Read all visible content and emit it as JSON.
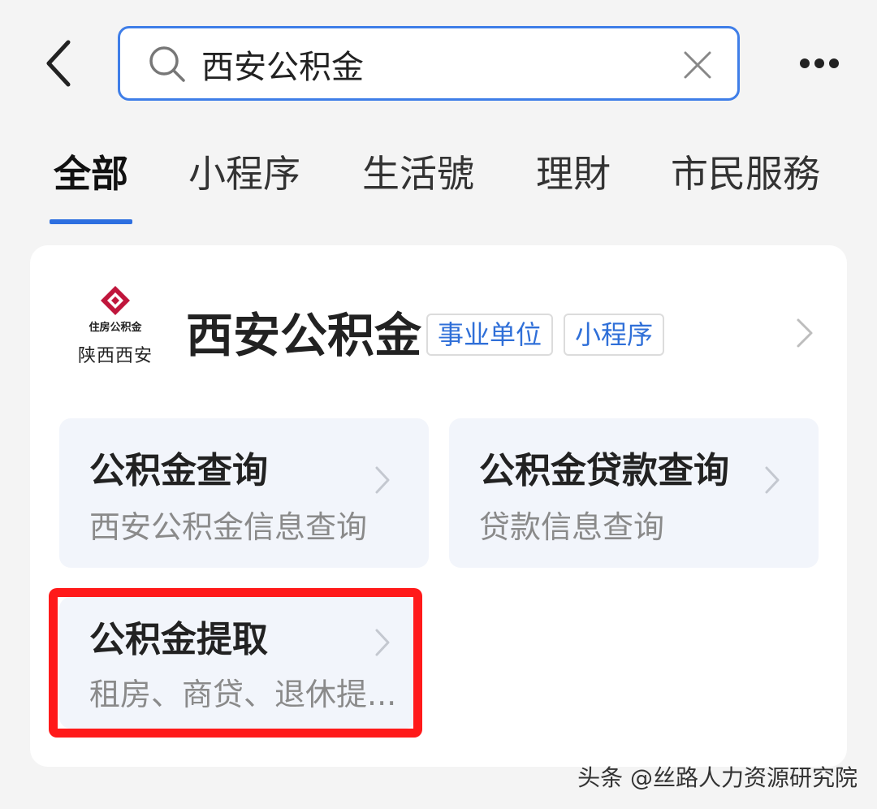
{
  "search": {
    "value": "西安公积金"
  },
  "tabs": [
    {
      "label": "全部",
      "active": true
    },
    {
      "label": "小程序",
      "active": false
    },
    {
      "label": "生活號",
      "active": false
    },
    {
      "label": "理財",
      "active": false
    },
    {
      "label": "市民服務",
      "active": false
    }
  ],
  "result": {
    "logo": {
      "small_text": "住房公积金",
      "big_text": "陕西西安"
    },
    "title": "西安公积金",
    "tags": [
      "事业单位",
      "小程序"
    ],
    "tiles": [
      {
        "title": "公积金查询",
        "subtitle": "西安公积金信息查询"
      },
      {
        "title": "公积金贷款查询",
        "subtitle": "贷款信息查询"
      },
      {
        "title": "公积金提取",
        "subtitle": "租房、商贷、退休提..."
      }
    ]
  },
  "watermark": "头条 @丝路人力资源研究院",
  "colors": {
    "accent": "#2d6fe0",
    "search_border": "#3f7ee8",
    "highlight": "#ff1a1a",
    "logo_red": "#c0163c"
  }
}
